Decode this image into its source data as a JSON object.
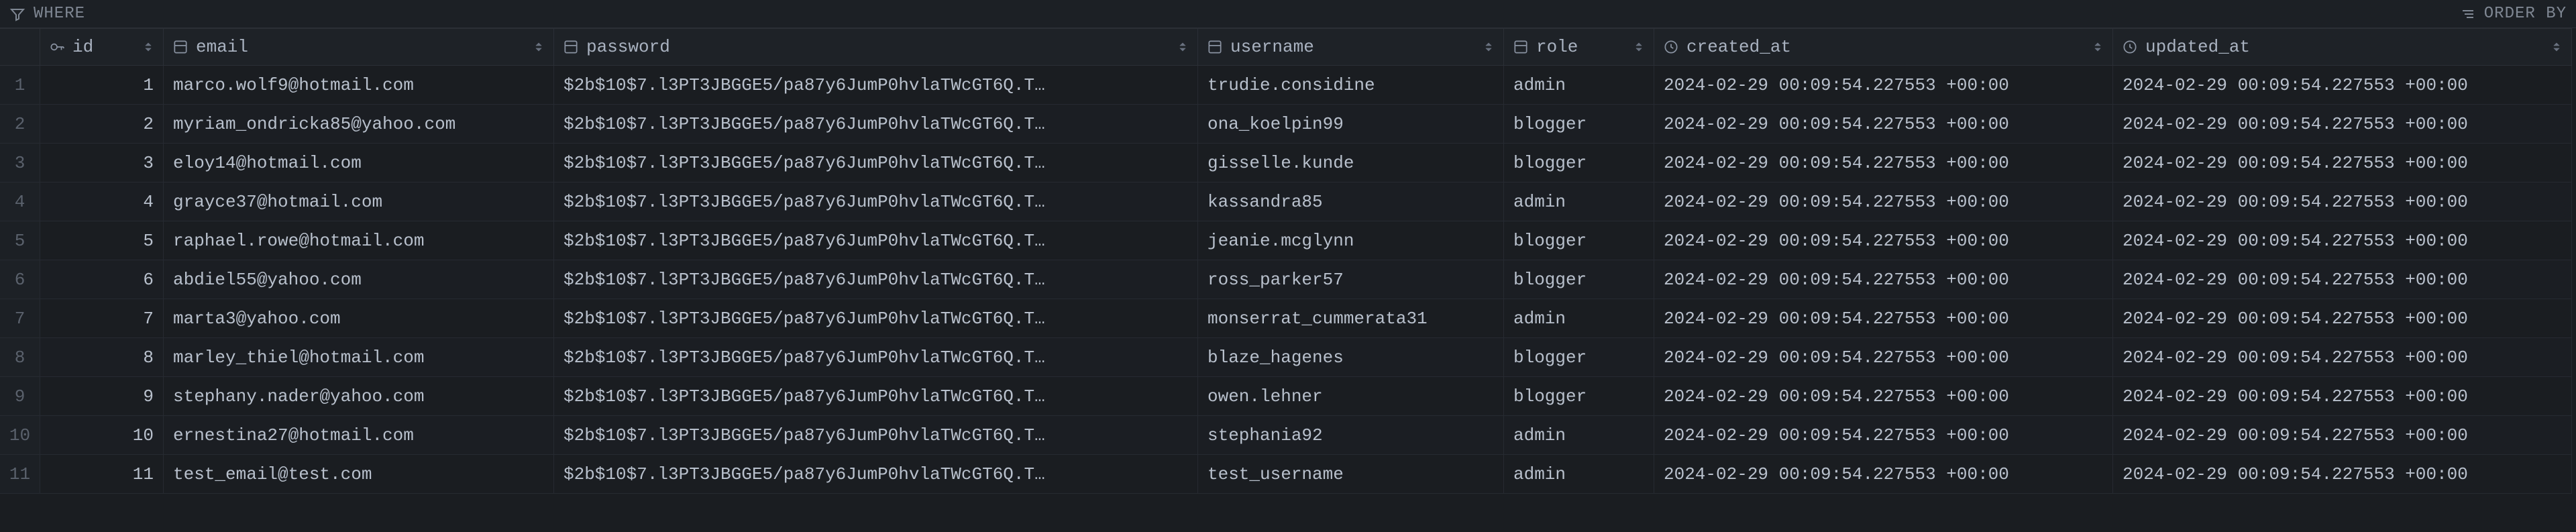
{
  "toolbar": {
    "where_label": "WHERE",
    "orderby_label": "ORDER BY"
  },
  "columns": [
    {
      "key": "id",
      "label": "id",
      "icon": "key"
    },
    {
      "key": "email",
      "label": "email",
      "icon": "col"
    },
    {
      "key": "password",
      "label": "password",
      "icon": "col"
    },
    {
      "key": "username",
      "label": "username",
      "icon": "col"
    },
    {
      "key": "role",
      "label": "role",
      "icon": "col"
    },
    {
      "key": "created_at",
      "label": "created_at",
      "icon": "clock"
    },
    {
      "key": "updated_at",
      "label": "updated_at",
      "icon": "clock"
    }
  ],
  "rows": [
    {
      "n": "1",
      "id": "1",
      "email": "marco.wolf9@hotmail.com",
      "password": "$2b$10$7.l3PT3JBGGE5/pa87y6JumP0hvlaTWcGT6Q.T…",
      "username": "trudie.considine",
      "role": "admin",
      "created_at": "2024-02-29 00:09:54.227553 +00:00",
      "updated_at": "2024-02-29 00:09:54.227553 +00:00"
    },
    {
      "n": "2",
      "id": "2",
      "email": "myriam_ondricka85@yahoo.com",
      "password": "$2b$10$7.l3PT3JBGGE5/pa87y6JumP0hvlaTWcGT6Q.T…",
      "username": "ona_koelpin99",
      "role": "blogger",
      "created_at": "2024-02-29 00:09:54.227553 +00:00",
      "updated_at": "2024-02-29 00:09:54.227553 +00:00"
    },
    {
      "n": "3",
      "id": "3",
      "email": "eloy14@hotmail.com",
      "password": "$2b$10$7.l3PT3JBGGE5/pa87y6JumP0hvlaTWcGT6Q.T…",
      "username": "gisselle.kunde",
      "role": "blogger",
      "created_at": "2024-02-29 00:09:54.227553 +00:00",
      "updated_at": "2024-02-29 00:09:54.227553 +00:00"
    },
    {
      "n": "4",
      "id": "4",
      "email": "grayce37@hotmail.com",
      "password": "$2b$10$7.l3PT3JBGGE5/pa87y6JumP0hvlaTWcGT6Q.T…",
      "username": "kassandra85",
      "role": "admin",
      "created_at": "2024-02-29 00:09:54.227553 +00:00",
      "updated_at": "2024-02-29 00:09:54.227553 +00:00"
    },
    {
      "n": "5",
      "id": "5",
      "email": "raphael.rowe@hotmail.com",
      "password": "$2b$10$7.l3PT3JBGGE5/pa87y6JumP0hvlaTWcGT6Q.T…",
      "username": "jeanie.mcglynn",
      "role": "blogger",
      "created_at": "2024-02-29 00:09:54.227553 +00:00",
      "updated_at": "2024-02-29 00:09:54.227553 +00:00"
    },
    {
      "n": "6",
      "id": "6",
      "email": "abdiel55@yahoo.com",
      "password": "$2b$10$7.l3PT3JBGGE5/pa87y6JumP0hvlaTWcGT6Q.T…",
      "username": "ross_parker57",
      "role": "blogger",
      "created_at": "2024-02-29 00:09:54.227553 +00:00",
      "updated_at": "2024-02-29 00:09:54.227553 +00:00"
    },
    {
      "n": "7",
      "id": "7",
      "email": "marta3@yahoo.com",
      "password": "$2b$10$7.l3PT3JBGGE5/pa87y6JumP0hvlaTWcGT6Q.T…",
      "username": "monserrat_cummerata31",
      "role": "admin",
      "created_at": "2024-02-29 00:09:54.227553 +00:00",
      "updated_at": "2024-02-29 00:09:54.227553 +00:00"
    },
    {
      "n": "8",
      "id": "8",
      "email": "marley_thiel@hotmail.com",
      "password": "$2b$10$7.l3PT3JBGGE5/pa87y6JumP0hvlaTWcGT6Q.T…",
      "username": "blaze_hagenes",
      "role": "blogger",
      "created_at": "2024-02-29 00:09:54.227553 +00:00",
      "updated_at": "2024-02-29 00:09:54.227553 +00:00"
    },
    {
      "n": "9",
      "id": "9",
      "email": "stephany.nader@yahoo.com",
      "password": "$2b$10$7.l3PT3JBGGE5/pa87y6JumP0hvlaTWcGT6Q.T…",
      "username": "owen.lehner",
      "role": "blogger",
      "created_at": "2024-02-29 00:09:54.227553 +00:00",
      "updated_at": "2024-02-29 00:09:54.227553 +00:00"
    },
    {
      "n": "10",
      "id": "10",
      "email": "ernestina27@hotmail.com",
      "password": "$2b$10$7.l3PT3JBGGE5/pa87y6JumP0hvlaTWcGT6Q.T…",
      "username": "stephania92",
      "role": "admin",
      "created_at": "2024-02-29 00:09:54.227553 +00:00",
      "updated_at": "2024-02-29 00:09:54.227553 +00:00"
    },
    {
      "n": "11",
      "id": "11",
      "email": "test_email@test.com",
      "password": "$2b$10$7.l3PT3JBGGE5/pa87y6JumP0hvlaTWcGT6Q.T…",
      "username": "test_username",
      "role": "admin",
      "created_at": "2024-02-29 00:09:54.227553 +00:00",
      "updated_at": "2024-02-29 00:09:54.227553 +00:00"
    }
  ]
}
